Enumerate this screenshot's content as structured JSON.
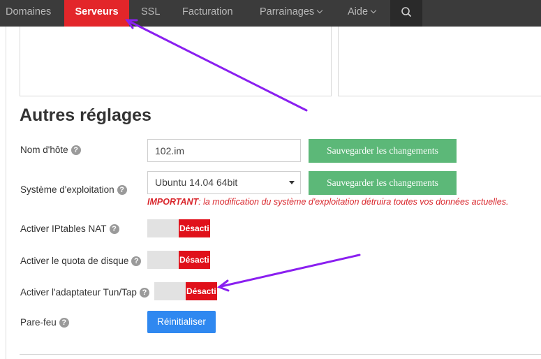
{
  "nav": {
    "items": [
      {
        "label": "Domaines"
      },
      {
        "label": "Serveurs"
      },
      {
        "label": "SSL"
      },
      {
        "label": "Facturation"
      },
      {
        "label": "Parrainages"
      },
      {
        "label": "Aide"
      }
    ],
    "active": "Serveurs",
    "search_icon": "search-icon",
    "active_color": "#e3262a"
  },
  "section": {
    "title": "Autres réglages"
  },
  "fields": {
    "hostname": {
      "label": "Nom d'hôte",
      "value": "102.im"
    },
    "os": {
      "label": "Système d'exploitation",
      "selected": "Ubuntu 14.04 64bit"
    },
    "iptables": {
      "label": "Activer IPtables NAT",
      "state": "Désacti"
    },
    "quota": {
      "label": "Activer le quota de disque",
      "state": "Désacti"
    },
    "tuntap": {
      "label": "Activer l'adaptateur Tun/Tap",
      "state": "Désacti"
    },
    "firewall": {
      "label": "Pare-feu"
    }
  },
  "buttons": {
    "save_hostname": "Sauvegarder les changements",
    "save_os": "Sauvegarder les changements",
    "reset": "Réinitialiser"
  },
  "warning": {
    "strong": "IMPORTANT",
    "text": ": la modification du système d'exploitation détruira toutes vos données actuelles."
  },
  "help_glyph": "?",
  "colors": {
    "save_button": "#5cb878",
    "reset_button": "#2f88f0",
    "toggle_off": "#e0101a",
    "warning": "#d9262c",
    "annotation_arrow": "#8a1ff0"
  }
}
